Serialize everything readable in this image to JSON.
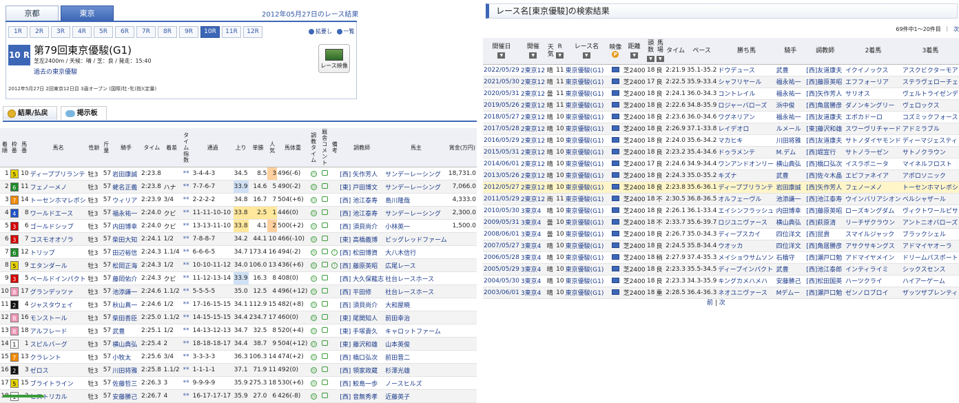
{
  "venue_tabs": [
    "京都",
    "東京"
  ],
  "date_title": "2012年05月27日のレース結果",
  "race_buttons": [
    "1R",
    "2R",
    "3R",
    "4R",
    "5R",
    "6R",
    "7R",
    "8R",
    "9R",
    "10R",
    "11R",
    "12R"
  ],
  "toggles": {
    "expand": "拡要し",
    "list": "一覧"
  },
  "race": {
    "number": "10 R",
    "name": "第79回東京優駿(G1)",
    "conditions": "芝左2400m / 天候：晴 / 芝：良 / 発走：15:40",
    "past_link": "過去の東京優駿",
    "video": "レース映像",
    "date_line": "2012年5月27日 2回東京12日目 3歳オープン (国際)牡･牝(指)(定量)"
  },
  "tabs": {
    "results": "結果/払戻",
    "board": "掲示板"
  },
  "results_headers": [
    "着順",
    "枠番",
    "馬番",
    "馬名",
    "性齢",
    "斤量",
    "騎手",
    "タイム",
    "着差",
    "タイム指数",
    "通過",
    "上り",
    "単勝",
    "人気",
    "馬体重",
    "調教タイム",
    "厩舎コメント",
    "備考",
    "調教師",
    "馬主",
    "賞金(万円)"
  ],
  "results": [
    [
      "1",
      "5",
      "10",
      "ディープブリランテ",
      "牡3",
      "57",
      "岩田康誠",
      "2:23.8",
      "",
      "**",
      "3-4-4-3",
      "34.5",
      "8.5",
      "3",
      "496(-6)",
      "[西] 矢作芳人",
      "サンデーレーシング",
      "18,731.0"
    ],
    [
      "2",
      "6",
      "11",
      "フェノーメノ",
      "牡3",
      "57",
      "蛯名正義",
      "2:23.8",
      "ハナ",
      "**",
      "7-7-6-7",
      "33.9",
      "14.6",
      "5",
      "490(-2)",
      "[東] 戸田博文",
      "サンデーレーシング",
      "7,066.0"
    ],
    [
      "3",
      "7",
      "14",
      "トーセンホマレボシ",
      "牡3",
      "57",
      "ウィリア",
      "2:23.9",
      "3/4",
      "**",
      "2-2-2-2",
      "34.8",
      "16.7",
      "7",
      "504(+6)",
      "[西] 池江泰寿",
      "島川隆哉",
      "4,333.0"
    ],
    [
      "4",
      "4",
      "8",
      "ワールドエース",
      "牡3",
      "57",
      "福永祐一",
      "2:24.0",
      "クビ",
      "**",
      "11-11-10-10",
      "33.8",
      "2.5",
      "1",
      "446(0)",
      "[西] 池江泰寿",
      "サンデーレーシング",
      "2,300.0"
    ],
    [
      "5",
      "3",
      "6",
      "ゴールドシップ",
      "牡3",
      "57",
      "内田博幸",
      "2:24.0",
      "クビ",
      "**",
      "13-13-11-10",
      "33.8",
      "4.1",
      "2",
      "500(+2)",
      "[西] 須貝尚介",
      "小林英一",
      "1,500.0"
    ],
    [
      "6",
      "3",
      "7",
      "コスモオオゾラ",
      "牡3",
      "57",
      "柴田大知",
      "2:24.1",
      "1/2",
      "**",
      "7-8-8-7",
      "34.2",
      "44.1",
      "10",
      "466(-10)",
      "[東] 高橋義博",
      "ビッグレッドファーム",
      ""
    ],
    [
      "7",
      "6",
      "12",
      "トリップ",
      "牡3",
      "57",
      "田辺裕信",
      "2:24.3",
      "1.1/4",
      "**",
      "6-6-6-5",
      "34.7",
      "173.4",
      "16",
      "494(-2)",
      "[西] 松田博資",
      "大八木信行",
      ""
    ],
    [
      "8",
      "5",
      "9",
      "エタンダール",
      "牡3",
      "57",
      "松岡正海",
      "2:24.3",
      "1/2",
      "**",
      "10-10-11-12",
      "34.0",
      "106.0",
      "13",
      "436(+6)",
      "[西] 藤原英昭",
      "広尾レース",
      ""
    ],
    [
      "9",
      "3",
      "5",
      "ベールドインパクト",
      "牡3",
      "57",
      "藤岡佑介",
      "2:24.3",
      "クビ",
      "**",
      "11-12-13-14",
      "33.9",
      "16.3",
      "8",
      "408(0)",
      "[西] 大久保龍志",
      "社台レースホース",
      ""
    ],
    [
      "10",
      "8",
      "17",
      "グランデッツァ",
      "牡3",
      "57",
      "池添謙一",
      "2:24.6",
      "1.1/2",
      "**",
      "5-5-5-5",
      "35.0",
      "12.5",
      "4",
      "496(+12)",
      "[西] 平田修",
      "社台レースホース",
      ""
    ],
    [
      "11",
      "2",
      "4",
      "ジャスタウェイ",
      "牡3",
      "57",
      "秋山真一",
      "2:24.6",
      "1/2",
      "**",
      "17-16-15-15",
      "34.1",
      "112.9",
      "15",
      "482(+8)",
      "[西] 須貝尚介",
      "大和屋暁",
      ""
    ],
    [
      "12",
      "8",
      "16",
      "モンストール",
      "牡3",
      "57",
      "柴田善臣",
      "2:25.0",
      "1.1/2",
      "**",
      "14-15-15-15",
      "34.4",
      "234.7",
      "17",
      "460(0)",
      "[東] 尾関知人",
      "前田幸治",
      ""
    ],
    [
      "13",
      "8",
      "18",
      "アルフレード",
      "牡3",
      "57",
      "武豊",
      "2:25.1",
      "1/2",
      "**",
      "14-13-12-13",
      "34.7",
      "32.5",
      "8",
      "520(+4)",
      "[東] 手塚貴久",
      "キャロットファーム",
      ""
    ],
    [
      "14",
      "1",
      "1",
      "スピルバーグ",
      "牡3",
      "57",
      "横山典弘",
      "2:25.4",
      "2",
      "**",
      "18-18-18-17",
      "34.4",
      "38.7",
      "9",
      "504(+12)",
      "[東] 藤沢和雄",
      "山本英俊",
      ""
    ],
    [
      "15",
      "7",
      "13",
      "クラレント",
      "牡3",
      "57",
      "小牧太",
      "2:25.6",
      "3/4",
      "**",
      "3-3-3-3",
      "36.3",
      "106.3",
      "14",
      "474(+2)",
      "[西] 橋口弘次",
      "前田晋二",
      ""
    ],
    [
      "16",
      "2",
      "3",
      "ゼロス",
      "牡3",
      "57",
      "川田将雅",
      "2:25.8",
      "1.1/2",
      "**",
      "1-1-1-1",
      "37.1",
      "71.9",
      "11",
      "492(0)",
      "[西] 領家政蔵",
      "杉澤光雄",
      ""
    ],
    [
      "17",
      "5",
      "15",
      "ブライトライン",
      "牡3",
      "57",
      "佐藤哲三",
      "2:26.3",
      "3",
      "**",
      "9-9-9-9",
      "35.9",
      "275.3",
      "18",
      "530(+6)",
      "[西] 鮫島一歩",
      "ノースヒルズ",
      ""
    ],
    [
      "18",
      "1",
      "2",
      "ヒストリカル",
      "牡3",
      "57",
      "安藤勝己",
      "2:26.7",
      "4",
      "**",
      "16-17-17-17",
      "35.9",
      "27.0",
      "6",
      "426(-8)",
      "[西] 音無秀孝",
      "近藤英子",
      ""
    ]
  ],
  "search": {
    "title": "レース名[東京優駿]の検索結果",
    "count": "69件中1〜20件目",
    "next": "次",
    "bottom_prev": "前",
    "bottom_next": "次"
  },
  "history_headers": [
    "開催日",
    "開催",
    "天気",
    "R",
    "レース名",
    "映像",
    "距離",
    "頭数",
    "馬場",
    "タイム",
    "ペース",
    "勝ち馬",
    "騎手",
    "調教師",
    "2着馬",
    "3着馬"
  ],
  "history": [
    [
      "2022/05/29",
      "2東京12",
      "晴",
      "11",
      "東京優駿(G1)",
      "芝2400",
      "18",
      "良",
      "2:21.9",
      "35.1-35.2",
      "ドウデュース",
      "武豊",
      "[西]友道康夫",
      "イクイノックス",
      "アスクビクターモア"
    ],
    [
      "2021/05/30",
      "2東京12",
      "晴",
      "11",
      "東京優駿(G1)",
      "芝2400",
      "17",
      "良",
      "2:22.5",
      "35.9-33.4",
      "シャフリヤール",
      "福永祐一",
      "[西]藤原英昭",
      "エフフォーリア",
      "ステラヴェローチェ"
    ],
    [
      "2020/05/31",
      "2東京12",
      "曇",
      "11",
      "東京優駿(G1)",
      "芝2400",
      "18",
      "良",
      "2:24.1",
      "36.0-34.3",
      "コントレイル",
      "福永祐一",
      "[西]矢作芳人",
      "サリオス",
      "ヴェルトライゼンデ"
    ],
    [
      "2019/05/26",
      "2東京12",
      "晴",
      "11",
      "東京優駿(G1)",
      "芝2400",
      "18",
      "良",
      "2:22.6",
      "34.8-35.9",
      "ロジャーバローズ",
      "浜中俊",
      "[西]角居勝彦",
      "ダノンキングリー",
      "ヴェロックス"
    ],
    [
      "2018/05/27",
      "2東京12",
      "晴",
      "10",
      "東京優駿(G1)",
      "芝2400",
      "18",
      "良",
      "2:23.6",
      "36.0-34.6",
      "ワグネリアン",
      "福永祐一",
      "[西]友道康夫",
      "エポカドーロ",
      "コズミックフォース"
    ],
    [
      "2017/05/28",
      "2東京12",
      "晴",
      "10",
      "東京優駿(G1)",
      "芝2400",
      "18",
      "良",
      "2:26.9",
      "37.1-33.8",
      "レイデオロ",
      "ルメール",
      "[東]藤沢和雄",
      "スワーヴリチャード",
      "アドミラブル"
    ],
    [
      "2016/05/29",
      "2東京12",
      "晴",
      "10",
      "東京優駿(G1)",
      "芝2400",
      "18",
      "良",
      "2:24.0",
      "35.6-34.2",
      "マカヒキ",
      "川田将雅",
      "[西]友道康夫",
      "サトノダイヤモンド",
      "ディーマジェスティ"
    ],
    [
      "2015/05/31",
      "2東京12",
      "晴",
      "10",
      "東京優駿(G1)",
      "芝2400",
      "18",
      "良",
      "2:23.2",
      "35.4-34.6",
      "ドゥラメンテ",
      "M.デム",
      "[西]堀宣行",
      "サトノラーゼン",
      "サトノクラウン"
    ],
    [
      "2014/06/01",
      "2東京12",
      "晴",
      "10",
      "東京優駿(G1)",
      "芝2400",
      "17",
      "良",
      "2:24.6",
      "34.9-34.4",
      "ワンアンドオンリー",
      "横山典弘",
      "[西]橋口弘次",
      "イスラボニータ",
      "マイネルフロスト"
    ],
    [
      "2013/05/26",
      "2東京12",
      "晴",
      "10",
      "東京優駿(G1)",
      "芝2400",
      "18",
      "良",
      "2:24.3",
      "35.0-35.2",
      "キズナ",
      "武豊",
      "[西]佐々木晶",
      "エピファネイア",
      "アポロソニック"
    ],
    [
      "2012/05/27",
      "2東京12",
      "晴",
      "10",
      "東京優駿(G1)",
      "芝2400",
      "18",
      "良",
      "2:23.8",
      "35.6-36.1",
      "ディープブリランテ",
      "岩田康誠",
      "[西]矢作芳人",
      "フェノーメノ",
      "トーセンホマレボシ"
    ],
    [
      "2011/05/29",
      "2東京12",
      "雨",
      "11",
      "東京優駿(G1)",
      "芝2400",
      "18",
      "不",
      "2:30.5",
      "36.8-36.5",
      "オルフェーヴル",
      "池添謙一",
      "[西]池江泰寿",
      "ウインバリアシオン",
      "ベルシャザール"
    ],
    [
      "2010/05/30",
      "3東京4",
      "晴",
      "10",
      "東京優駿(G1)",
      "芝2400",
      "18",
      "良",
      "2:26.1",
      "36.1-33.4",
      "エイシンフラッシュ",
      "内田博幸",
      "[西]藤原英昭",
      "ローズキングダム",
      "ヴィクトワールピサ"
    ],
    [
      "2009/05/31",
      "3東京4",
      "曇",
      "10",
      "東京優駿(G1)",
      "芝2400",
      "18",
      "不",
      "2:33.7",
      "35.6-39.7",
      "ロジユニヴァース",
      "横山典弘",
      "[西]萩原清",
      "リーチザクラウン",
      "アントニオバローズ"
    ],
    [
      "2008/06/01",
      "3東京4",
      "曇",
      "10",
      "東京優駿(G1)",
      "芝2400",
      "18",
      "良",
      "2:26.7",
      "35.0-34.3",
      "ディープスカイ",
      "四位洋文",
      "[西]昆貢",
      "スマイルジャック",
      "ブラックシェル"
    ],
    [
      "2007/05/27",
      "3東京4",
      "晴",
      "10",
      "東京優駿(G1)",
      "芝2400",
      "18",
      "良",
      "2:24.5",
      "35.8-34.4",
      "ウオッカ",
      "四位洋文",
      "[西]角居勝彦",
      "アサクサキングス",
      "アドマイヤオーラ"
    ],
    [
      "2006/05/28",
      "3東京4",
      "晴",
      "10",
      "東京優駿(G1)",
      "芝2400",
      "18",
      "稍",
      "2:27.9",
      "37.4-35.3",
      "メイショウサムソン",
      "石橋守",
      "[西]瀬戸口勉",
      "アドマイヤメイン",
      "ドリームパスポート"
    ],
    [
      "2005/05/29",
      "3東京4",
      "晴",
      "10",
      "東京優駿(G1)",
      "芝2400",
      "18",
      "良",
      "2:23.3",
      "35.5-34.5",
      "ディープインパクト",
      "武豊",
      "[西]池江泰郎",
      "インティライミ",
      "シックスセンス"
    ],
    [
      "2004/05/30",
      "3東京4",
      "晴",
      "10",
      "東京優駿(G1)",
      "芝2400",
      "18",
      "良",
      "2:23.3",
      "34.3-35.9",
      "キングカメハメハ",
      "安藤勝己",
      "[西]松田国英",
      "ハーツクライ",
      "ハイアーゲーム"
    ],
    [
      "2003/06/01",
      "3東京4",
      "晴",
      "10",
      "東京優駿(G1)",
      "芝2400",
      "18",
      "重",
      "2:28.5",
      "36.4-36.3",
      "ネオユニヴァース",
      "Mデムー",
      "[西]瀬戸口勉",
      "ゼンノロブロイ",
      "ザッツザプレンティ"
    ]
  ]
}
